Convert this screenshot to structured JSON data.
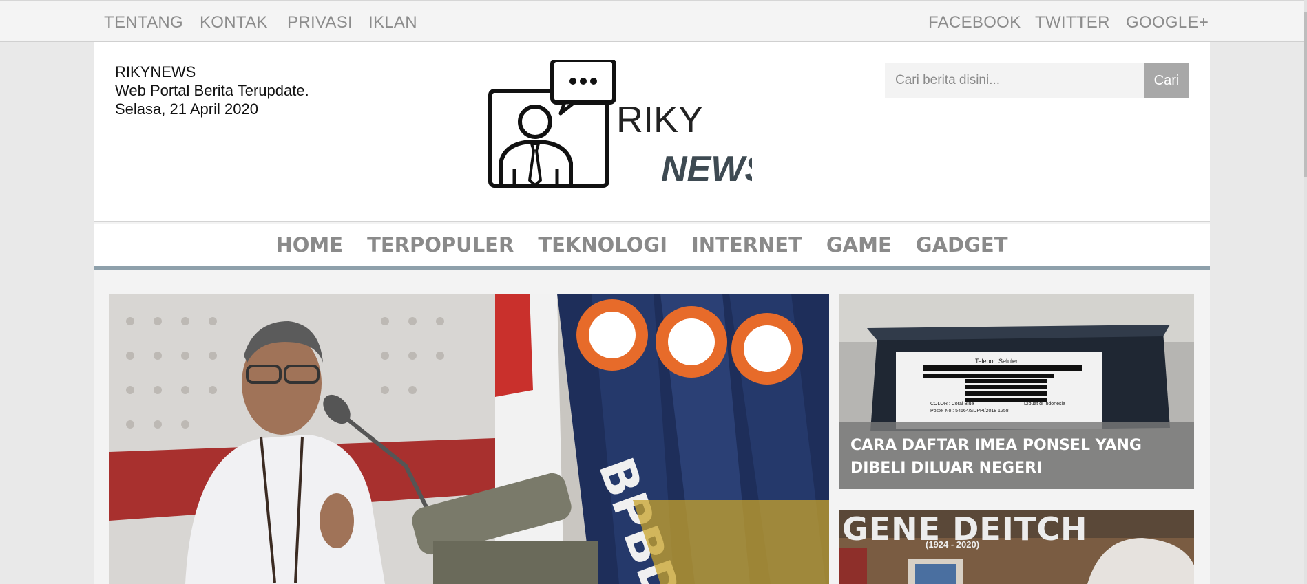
{
  "topbar": {
    "left_links": [
      "TENTANG",
      "KONTAK",
      "PRIVASI",
      "IKLAN"
    ],
    "right_links": [
      "FACEBOOK",
      "TWITTER",
      "GOOGLE+"
    ]
  },
  "site": {
    "name": "RIKYNEWS",
    "tagline": "Web Portal Berita Terupdate.",
    "date": "Selasa, 21 April 2020"
  },
  "logo": {
    "line1": "RIKY",
    "line2": "NEWS"
  },
  "search": {
    "placeholder": "Cari berita disini...",
    "button_label": "Cari"
  },
  "nav": {
    "items": [
      "HOME",
      "TERPOPULER",
      "TEKNOLOGI",
      "INTERNET",
      "GAME",
      "GADGET"
    ]
  },
  "features": {
    "side_1_title": "CARA DAFTAR IMEA PONSEL YANG DIBELI DILUAR NEGERI",
    "side_2_image_title": "GENE DEITCH",
    "side_2_image_years": "(1924 - 2020)",
    "side_1_label_header": "Telepon Seluler",
    "side_1_label_color": "COLOR : Coral Blue",
    "side_1_label_made": "Dibuat di Indonesia",
    "side_1_label_postel": "Postel No : 54664/SDPPI/2018 1258",
    "main_flag_text": "BPBD"
  },
  "colors": {
    "nav_border": "#8ea0ab",
    "link_gray": "#8c8c8c",
    "search_button": "#a8a8a8"
  }
}
